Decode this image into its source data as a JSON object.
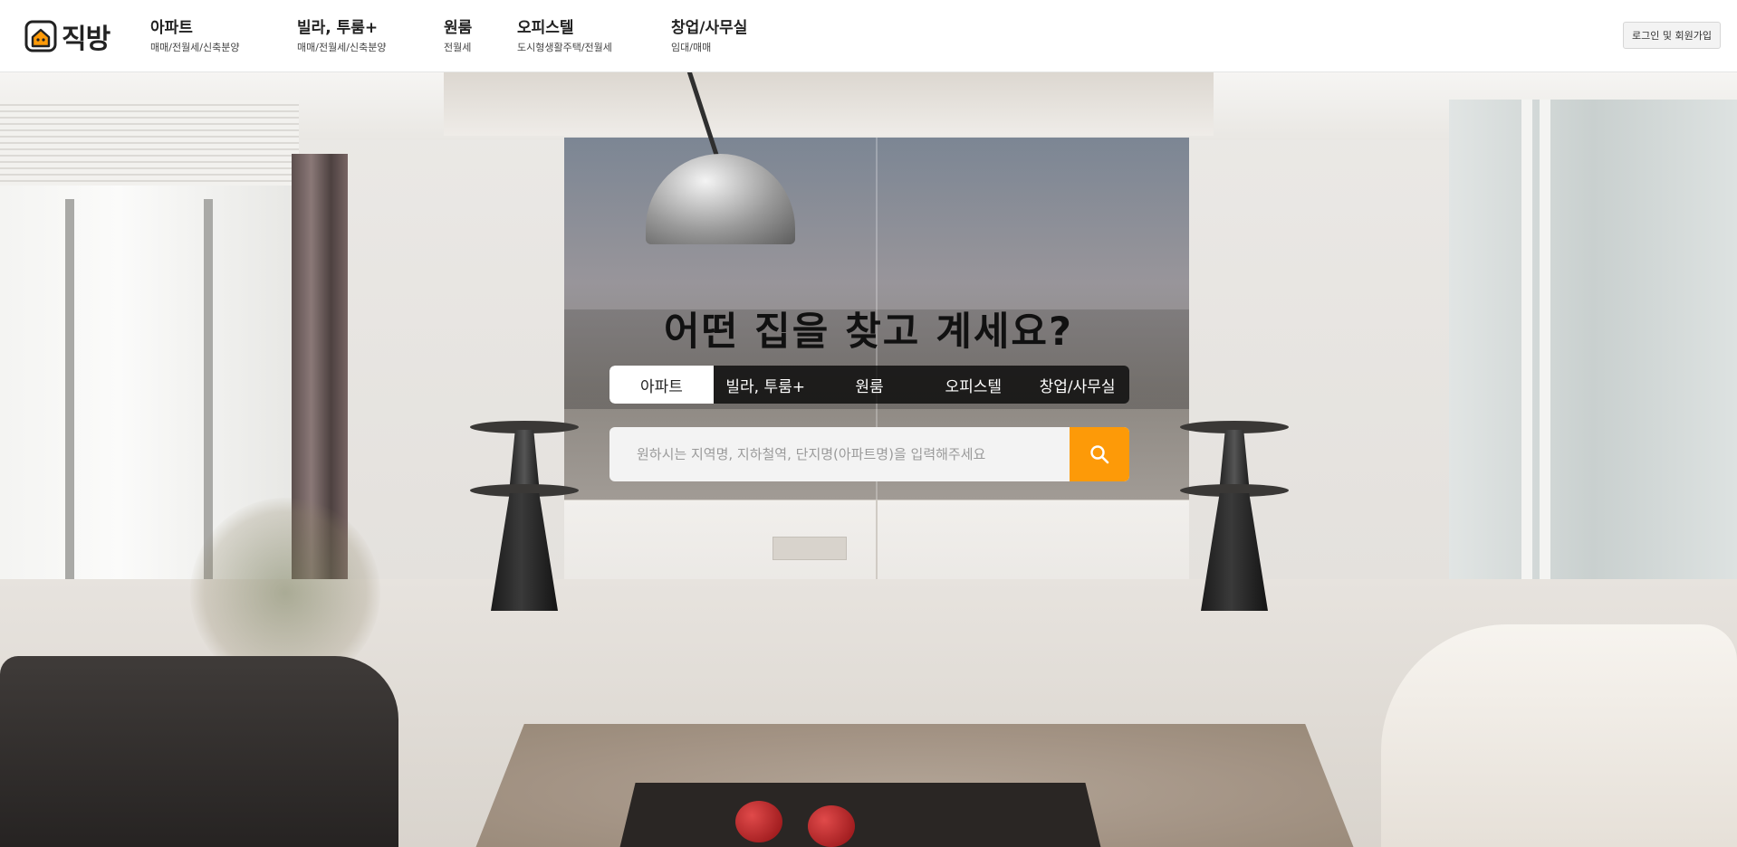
{
  "header": {
    "logo": {
      "text": "직방",
      "icon": "house-logo-icon",
      "brand_color": "#fd9a08"
    },
    "nav": [
      {
        "title": "아파트",
        "sub": "매매/전월세/신축분양"
      },
      {
        "title": "빌라, 투룸+",
        "sub": "매매/전월세/신축분양"
      },
      {
        "title": "원룸",
        "sub": "전월세"
      },
      {
        "title": "오피스텔",
        "sub": "도시형생활주택/전월세"
      },
      {
        "title": "창업/사무실",
        "sub": "임대/매매"
      }
    ],
    "login_label": "로그인 및 회원가입"
  },
  "hero": {
    "headline": "어떤 집을 찾고 계세요?",
    "tabs": [
      {
        "label": "아파트",
        "active": true
      },
      {
        "label": "빌라, 투룸+",
        "active": false
      },
      {
        "label": "원룸",
        "active": false
      },
      {
        "label": "오피스텔",
        "active": false
      },
      {
        "label": "창업/사무실",
        "active": false
      }
    ],
    "search": {
      "placeholder": "원하시는 지역명, 지하철역, 단지명(아파트명)을 입력해주세요",
      "value": "",
      "button_icon": "search-icon",
      "button_color": "#fd9a08"
    }
  }
}
